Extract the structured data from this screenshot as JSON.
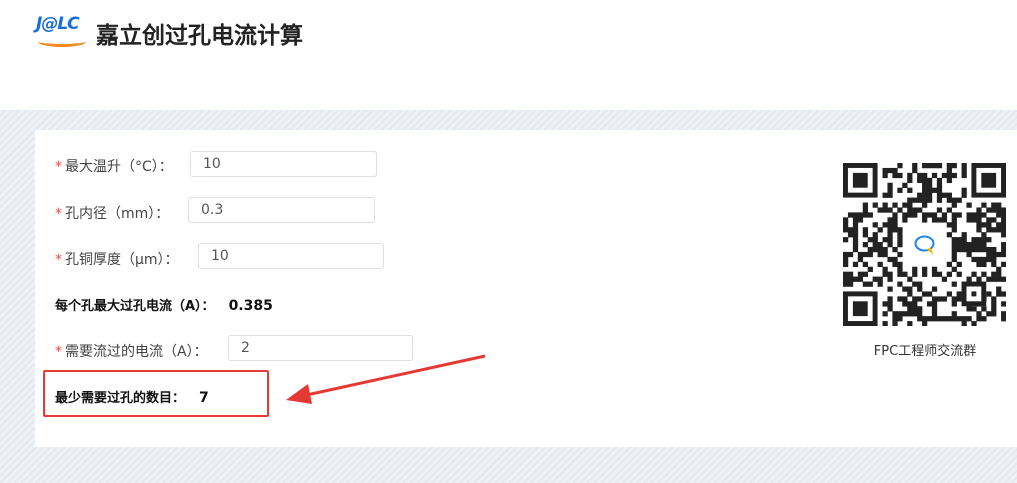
{
  "header": {
    "logo_text": "J@LC",
    "title": "嘉立创过孔电流计算"
  },
  "form": {
    "required_mark": "*",
    "max_temp_rise": {
      "label": "最大温升（°C）：",
      "value": "10"
    },
    "hole_diameter": {
      "label": "孔内径（mm）：",
      "value": "0.3"
    },
    "copper_thickness": {
      "label": "孔铜厚度（μm）：",
      "value": "10"
    },
    "max_current_per_hole": {
      "label": "每个孔最大过孔电流（A）：",
      "value": "0.385"
    },
    "required_current": {
      "label": "需要流过的电流（A）：",
      "value": "2"
    },
    "min_holes": {
      "label": "最少需要过孔的数目：",
      "value": "7"
    }
  },
  "qr": {
    "caption": "FPC工程师交流群",
    "icon": "chat-bubble-icon"
  },
  "colors": {
    "accent_red": "#e53935",
    "logo_blue": "#1a6fd6",
    "logo_orange": "#f08a1c"
  }
}
